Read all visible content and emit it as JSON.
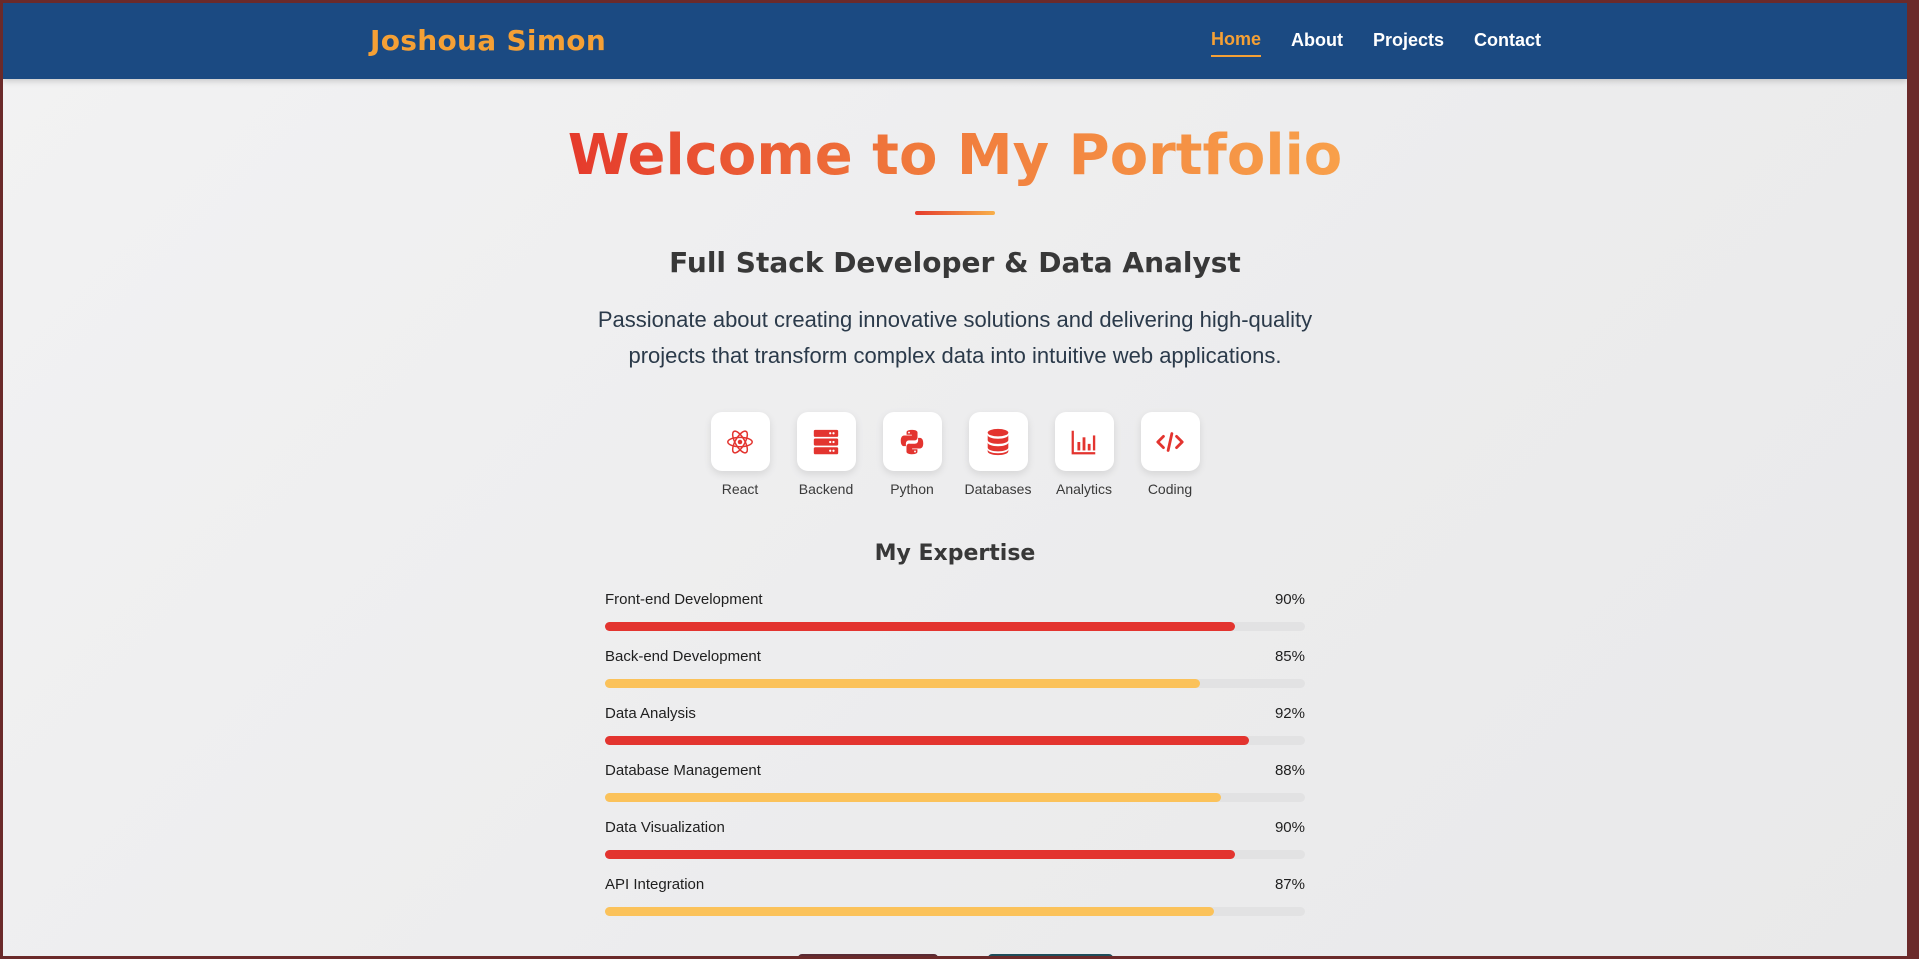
{
  "header": {
    "brand": "Joshoua Simon",
    "nav": [
      {
        "label": "Home",
        "active": true
      },
      {
        "label": "About",
        "active": false
      },
      {
        "label": "Projects",
        "active": false
      },
      {
        "label": "Contact",
        "active": false
      }
    ]
  },
  "hero": {
    "title": "Welcome to My Portfolio",
    "subtitle": "Full Stack Developer & Data Analyst",
    "tagline": "Passionate about creating innovative solutions and delivering high-quality projects that transform complex data into intuitive web applications."
  },
  "skills": [
    {
      "label": "React",
      "icon": "react-icon"
    },
    {
      "label": "Backend",
      "icon": "server-icon"
    },
    {
      "label": "Python",
      "icon": "python-icon"
    },
    {
      "label": "Databases",
      "icon": "database-icon"
    },
    {
      "label": "Analytics",
      "icon": "chart-icon"
    },
    {
      "label": "Coding",
      "icon": "code-icon"
    }
  ],
  "expertise": {
    "title": "My Expertise",
    "items": [
      {
        "name": "Front-end Development",
        "percent_label": "90%",
        "value": 90,
        "color": "#e3342f"
      },
      {
        "name": "Back-end Development",
        "percent_label": "85%",
        "value": 85,
        "color": "#fbc25a"
      },
      {
        "name": "Data Analysis",
        "percent_label": "92%",
        "value": 92,
        "color": "#e3342f"
      },
      {
        "name": "Database Management",
        "percent_label": "88%",
        "value": 88,
        "color": "#fbc25a"
      },
      {
        "name": "Data Visualization",
        "percent_label": "90%",
        "value": 90,
        "color": "#e3342f"
      },
      {
        "name": "API Integration",
        "percent_label": "87%",
        "value": 87,
        "color": "#fbc25a"
      }
    ]
  },
  "colors": {
    "navbar": "#1b4a82",
    "accent_orange": "#f5a035",
    "accent_red": "#e3342f",
    "accent_yellow": "#fbc25a"
  }
}
